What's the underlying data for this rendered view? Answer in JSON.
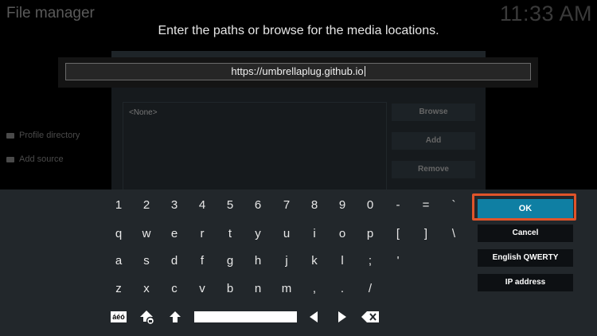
{
  "background": {
    "title": "File manager",
    "clock": "11:33 AM",
    "side_items": [
      "Profile directory",
      "Add source"
    ],
    "list_placeholder": "<None>",
    "dialog_buttons": [
      "Browse",
      "Add",
      "Remove"
    ]
  },
  "prompt": "Enter the paths or browse for the media locations.",
  "input": {
    "value": "https://umbrellaplug.github.io"
  },
  "keyboard": {
    "rows": [
      [
        "1",
        "2",
        "3",
        "4",
        "5",
        "6",
        "7",
        "8",
        "9",
        "0",
        "-",
        "=",
        "`"
      ],
      [
        "q",
        "w",
        "e",
        "r",
        "t",
        "y",
        "u",
        "i",
        "o",
        "p",
        "[",
        "]",
        "\\"
      ],
      [
        "a",
        "s",
        "d",
        "f",
        "g",
        "h",
        "j",
        "k",
        "l",
        ";",
        "'"
      ],
      [
        "z",
        "x",
        "c",
        "v",
        "b",
        "n",
        "m",
        ",",
        ".",
        "/"
      ]
    ],
    "symbols_label": "áéó"
  },
  "side_buttons": {
    "ok": "OK",
    "cancel": "Cancel",
    "layout": "English QWERTY",
    "ip": "IP address"
  },
  "colors": {
    "accent": "#0f7fa3",
    "highlight": "#e0542a",
    "keyboard_bg": "#22272b"
  }
}
